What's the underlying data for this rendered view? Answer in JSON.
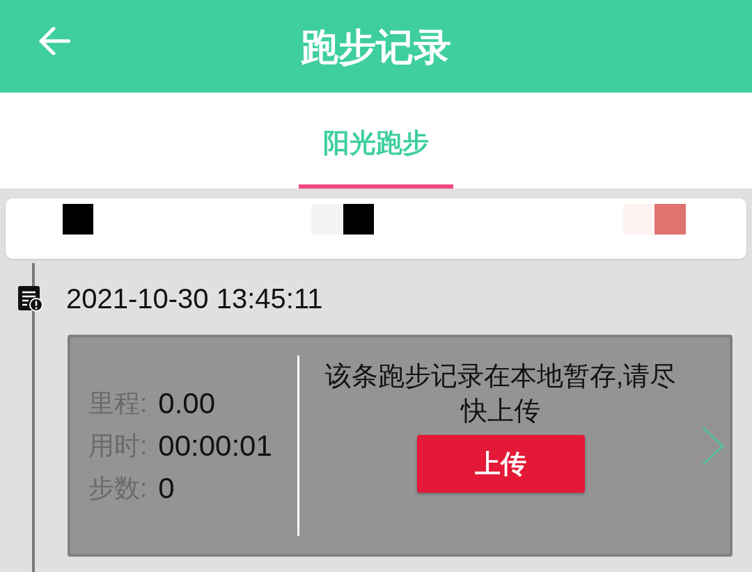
{
  "app_bar": {
    "title": "跑步记录"
  },
  "tabs": [
    {
      "label": "阳光跑步",
      "selected": true
    }
  ],
  "records": [
    {
      "time": "2021-10-30 13:45:11",
      "stats": [
        {
          "label": "里程:",
          "value": "0.00"
        },
        {
          "label": "用时:",
          "value": "00:00:01"
        },
        {
          "label": "步数:",
          "value": "0"
        }
      ],
      "message": "该条跑步记录在本地暂存,请尽快上传",
      "upload_button": "上传"
    }
  ]
}
